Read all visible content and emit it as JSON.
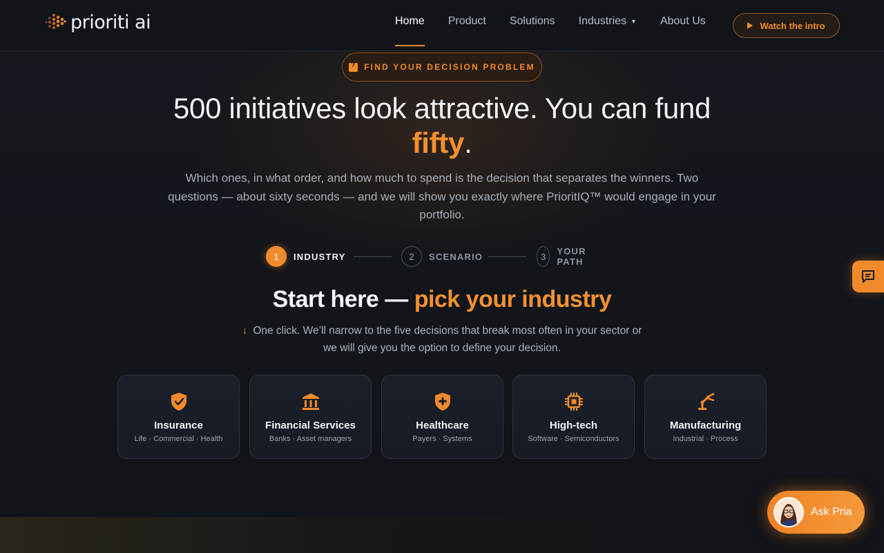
{
  "nav": {
    "logo_text": "prioriti ai",
    "links": [
      {
        "label": "Home",
        "active": true
      },
      {
        "label": "Product"
      },
      {
        "label": "Solutions"
      },
      {
        "label": "Industries",
        "has_caret": true
      },
      {
        "label": "About Us"
      }
    ],
    "intro_button": "Watch the intro"
  },
  "hero": {
    "pill": "FIND YOUR DECISION PROBLEM",
    "headline_part1": "500 initiatives look attractive. You can fund ",
    "headline_accent": "fifty",
    "headline_end": ".",
    "subtitle": "Which ones, in what order, and how much to spend is the decision that separates the winners. Two questions — about sixty seconds — and we will show you exactly where PrioritIQ™ would engage in your portfolio."
  },
  "stepper": {
    "steps": [
      {
        "num": "1",
        "label": "INDUSTRY",
        "active": true
      },
      {
        "num": "2",
        "label": "SCENARIO"
      },
      {
        "num": "3",
        "label": "YOUR PATH"
      }
    ]
  },
  "section": {
    "title_part1": "Start here — ",
    "title_accent": "pick your industry",
    "subtitle": "One click. We’ll narrow to the five decisions that break most often in your sector or we will give you the option to define your decision."
  },
  "industries": [
    {
      "title": "Insurance",
      "sub": "Life · Commercial · Health",
      "icon": "shield-check-icon"
    },
    {
      "title": "Financial Services",
      "sub": "Banks · Asset managers",
      "icon": "bank-icon"
    },
    {
      "title": "Healthcare",
      "sub": "Payers · Systems",
      "icon": "shield-plus-icon"
    },
    {
      "title": "High-tech",
      "sub": "Software · Semiconductors",
      "icon": "chip-icon"
    },
    {
      "title": "Manufacturing",
      "sub": "Industrial · Process",
      "icon": "robot-arm-icon"
    }
  ],
  "assistant": {
    "label": "Ask Pria"
  },
  "colors": {
    "accent": "#f08a2a",
    "background": "#111419"
  }
}
